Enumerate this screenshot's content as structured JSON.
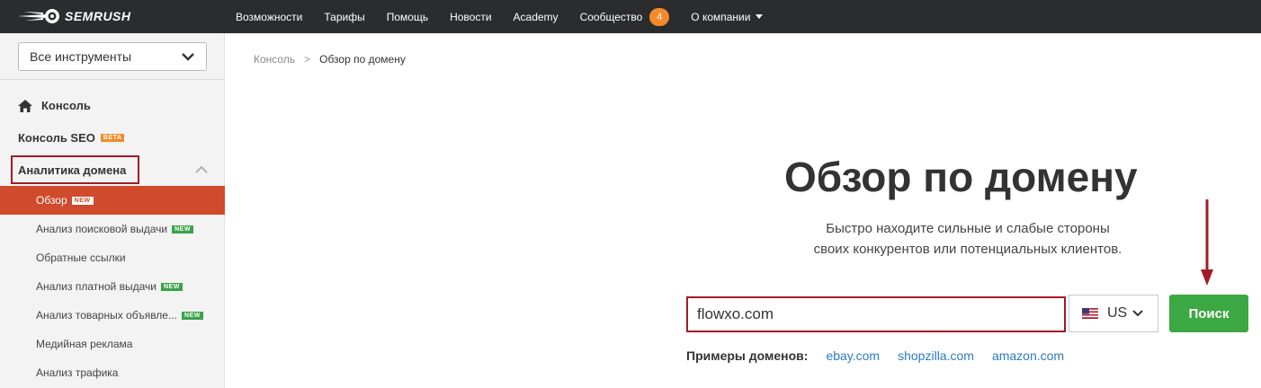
{
  "header": {
    "logo_text": "SEMRUSH",
    "nav": [
      {
        "label": "Возможности"
      },
      {
        "label": "Тарифы"
      },
      {
        "label": "Помощь"
      },
      {
        "label": "Новости"
      },
      {
        "label": "Academy"
      },
      {
        "label": "Сообщество",
        "badge": "4"
      },
      {
        "label": "О компании"
      }
    ]
  },
  "sidebar": {
    "tools_select": "Все инструменты",
    "console": "Консоль",
    "seo_console": "Консоль SEO",
    "beta_tag": "BETA",
    "domain_analytics": "Аналитика домена",
    "items": [
      {
        "label": "Обзор",
        "tag": "NEW"
      },
      {
        "label": "Анализ поисковой выдачи",
        "tag": "NEW"
      },
      {
        "label": "Обратные ссылки"
      },
      {
        "label": "Анализ платной выдачи",
        "tag": "NEW"
      },
      {
        "label": "Анализ товарных объявле...",
        "tag": "NEW"
      },
      {
        "label": "Медийная реклама"
      },
      {
        "label": "Анализ трафика"
      }
    ]
  },
  "breadcrumb": {
    "root": "Консоль",
    "separator": ">",
    "current": "Обзор по домену"
  },
  "main": {
    "title": "Обзор по домену",
    "subtitle_line1": "Быстро находите сильные и слабые стороны",
    "subtitle_line2": "своих конкурентов или потенциальных клиентов.",
    "domain_value": "flowxo.com",
    "country": "US",
    "search_button": "Поиск",
    "examples_label": "Примеры доменов:",
    "examples": [
      "ebay.com",
      "shopzilla.com",
      "amazon.com"
    ]
  },
  "colors": {
    "topbar": "#2a2c2e",
    "accent_orange": "#f58a2a",
    "active_item": "#d04a2c",
    "highlight_red": "#a31b24",
    "search_green": "#3ca844",
    "link_blue": "#2b7bc0"
  }
}
